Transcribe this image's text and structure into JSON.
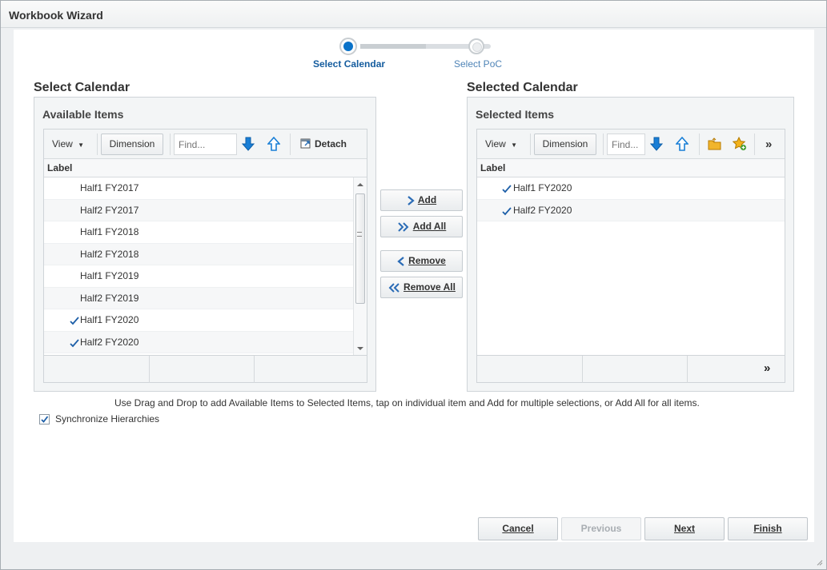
{
  "window": {
    "title": "Workbook Wizard"
  },
  "train": {
    "steps": [
      {
        "label": "Select Calendar",
        "state": "current"
      },
      {
        "label": "Select PoC",
        "state": "upcoming"
      }
    ]
  },
  "left": {
    "section_title": "Select Calendar",
    "panel_title": "Available Items",
    "toolbar": {
      "view_label": "View",
      "dimension_label": "Dimension",
      "find_placeholder": "Find...",
      "detach_label": "Detach"
    },
    "column_header": "Label",
    "rows": [
      {
        "label": "Half1 FY2017",
        "checked": false
      },
      {
        "label": "Half2 FY2017",
        "checked": false
      },
      {
        "label": "Half1 FY2018",
        "checked": false
      },
      {
        "label": "Half2 FY2018",
        "checked": false
      },
      {
        "label": "Half1 FY2019",
        "checked": false
      },
      {
        "label": "Half2 FY2019",
        "checked": false
      },
      {
        "label": "Half1 FY2020",
        "checked": true
      },
      {
        "label": "Half2 FY2020",
        "checked": true
      }
    ]
  },
  "right": {
    "section_title": "Selected Calendar",
    "panel_title": "Selected Items",
    "toolbar": {
      "view_label": "View",
      "dimension_label": "Dimension",
      "find_placeholder": "Find...",
      "more_label": "»"
    },
    "column_header": "Label",
    "rows": [
      {
        "label": "Half1 FY2020",
        "checked": true
      },
      {
        "label": "Half2 FY2020",
        "checked": true
      }
    ],
    "footer_more": "»"
  },
  "shuttle": {
    "add": "Add",
    "add_all": "Add All",
    "remove": "Remove",
    "remove_all": "Remove All"
  },
  "help_text": "Use Drag and Drop to add Available Items to Selected Items, tap on individual item and Add for multiple selections, or Add All for all items.",
  "sync": {
    "label": "Synchronize Hierarchies",
    "checked": true
  },
  "footer": {
    "cancel": "Cancel",
    "previous": "Previous",
    "next": "Next",
    "finish": "Finish"
  },
  "colors": {
    "accent": "#0a72c9",
    "check": "#1d5fa8",
    "arrow_blue": "#1a7fd6"
  }
}
